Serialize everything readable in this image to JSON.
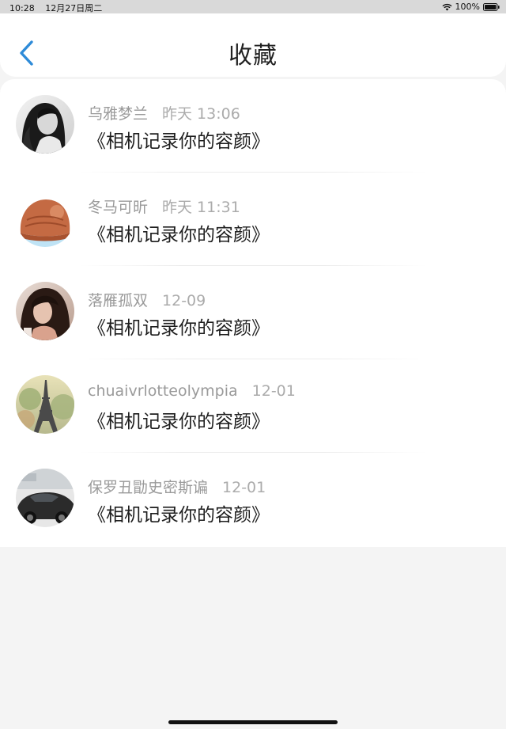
{
  "status_bar": {
    "time": "10:28",
    "date": "12月27日周二",
    "battery": "100%",
    "wifi_icon": "wifi-icon",
    "battery_icon": "battery-icon"
  },
  "header": {
    "title": "收藏",
    "back_icon": "chevron-left-icon",
    "accent_color": "#2e8bd8"
  },
  "favorites": [
    {
      "author": "乌雅梦兰",
      "time": "昨天 13:06",
      "title": "《相机记录你的容颜》",
      "avatar": "woman-portrait-bw"
    },
    {
      "author": "冬马可昕",
      "time": "昨天 11:31",
      "title": "《相机记录你的容颜》",
      "avatar": "knit-hat"
    },
    {
      "author": "落雁孤双",
      "time": "12-09",
      "title": "《相机记录你的容颜》",
      "avatar": "woman-portrait"
    },
    {
      "author": "chuaivrlotteolympia",
      "time": "12-01",
      "title": "《相机记录你的容颜》",
      "avatar": "eiffel-tower"
    },
    {
      "author": "保罗丑勖史密斯谝",
      "time": "12-01",
      "title": "《相机记录你的容颜》",
      "avatar": "sports-car"
    }
  ]
}
